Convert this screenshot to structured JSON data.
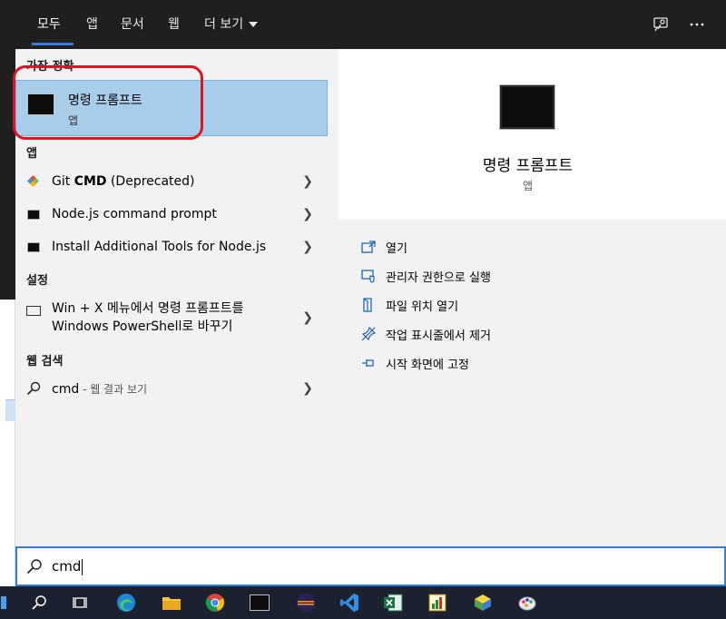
{
  "tabs": [
    {
      "label": "모두",
      "active": true
    },
    {
      "label": "앱"
    },
    {
      "label": "문서"
    },
    {
      "label": "웹"
    },
    {
      "label": "더 보기"
    }
  ],
  "left": {
    "best_match_heading": "가장 정확",
    "best_match": {
      "title": "명령 프롬프트",
      "subtitle": "앱"
    },
    "apps_heading": "앱",
    "apps": [
      {
        "pre": "Git ",
        "bold": "CMD",
        "post": " (Deprecated)"
      },
      {
        "label": "Node.js command prompt"
      },
      {
        "label": "Install Additional Tools for Node.js"
      }
    ],
    "settings_heading": "설정",
    "settings_item": {
      "line1": "Win + X 메뉴에서 명령 프롬프트를",
      "line2": "Windows PowerShell로 바꾸기"
    },
    "web_heading": "웹 검색",
    "web_item": {
      "query": "cmd",
      "suffix": " - 웹 결과 보기"
    }
  },
  "right": {
    "title": "명령 프롬프트",
    "subtitle": "앱",
    "actions": [
      "열기",
      "관리자 권한으로 실행",
      "파일 위치 열기",
      "작업 표시줄에서 제거",
      "시작 화면에 고정"
    ]
  },
  "search": {
    "value": "cmd"
  },
  "colors": {
    "accent": "#2f7de1",
    "highlight": "#a8cdea",
    "annotation": "#e0141e"
  }
}
